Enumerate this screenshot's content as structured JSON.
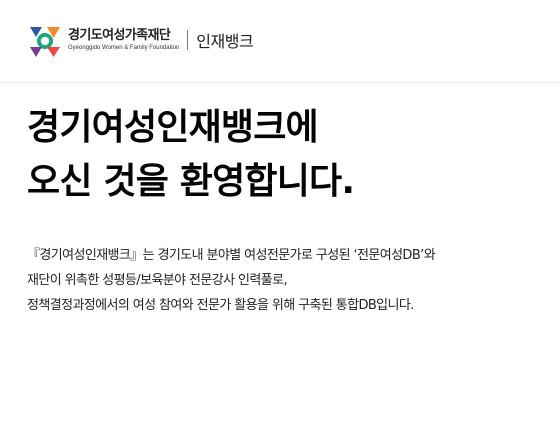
{
  "header": {
    "org_name_ko": "경기도여성가족재단",
    "org_name_en": "Gyeonggido Women & Family Foundation",
    "service_name": "인재뱅크"
  },
  "hero": {
    "title_line1": "경기여성인재뱅크에",
    "title_line2": "오신 것을 환영합니다."
  },
  "intro": {
    "line1": "『경기여성인재뱅크』는 경기도내 분야별 여성전문가로 구성된 ‘전문여성DB’와",
    "line2": "재단이 위촉한 성평등/보육분야 전문강사 인력풀로,",
    "line3": "정책결정과정에서의 여성 참여와 전문가 활용을 위해 구축된 통합DB입니다."
  },
  "colors": {
    "logo_blue": "#2f55a5",
    "logo_orange": "#f28c28",
    "logo_green": "#19a77f",
    "logo_purple": "#7a3b96",
    "logo_red": "#e94b43",
    "title_text": "#050505",
    "body_text": "#222222"
  }
}
